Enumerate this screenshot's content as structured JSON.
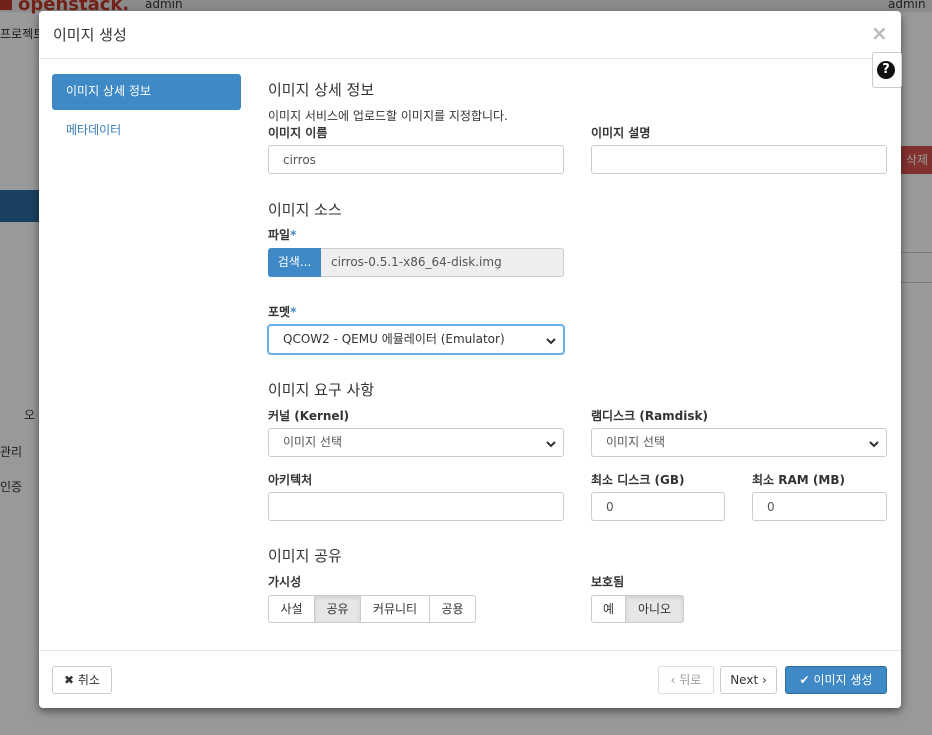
{
  "background": {
    "logo": "openstack.",
    "user_left": "admin",
    "user_right": "admin",
    "project": "프로젝트",
    "side_items": [
      "오",
      "관리",
      "인증"
    ],
    "red_button": "삭제"
  },
  "modal": {
    "title": "이미지 생성",
    "close": "×",
    "help": "?",
    "nav": {
      "active": "이미지 상세 정보",
      "item": "메타데이터"
    },
    "details": {
      "heading": "이미지 상세 정보",
      "help_text": "이미지 서비스에 업로드할 이미지를 지정합니다.",
      "name_label": "이미지 이름",
      "name_value": "cirros",
      "desc_label": "이미지 설명",
      "desc_value": ""
    },
    "source": {
      "heading": "이미지 소스",
      "file_label": "파일",
      "browse": "검색...",
      "file_name": "cirros-0.5.1-x86_64-disk.img",
      "format_label": "포멧",
      "format_value": "QCOW2 - QEMU 에뮬레이터 (Emulator)"
    },
    "requirements": {
      "heading": "이미지 요구 사항",
      "kernel_label": "커널 (Kernel)",
      "kernel_value": "이미지 선택",
      "ramdisk_label": "램디스크 (Ramdisk)",
      "ramdisk_value": "이미지 선택",
      "arch_label": "아키텍처",
      "arch_value": "",
      "min_disk_label": "최소 디스크 (GB)",
      "min_disk_value": "0",
      "min_ram_label": "최소 RAM (MB)",
      "min_ram_value": "0"
    },
    "sharing": {
      "heading": "이미지 공유",
      "visibility_label": "가시성",
      "visibility_options": [
        "사설",
        "공유",
        "커뮤니티",
        "공용"
      ],
      "visibility_selected": "공유",
      "protected_label": "보호됨",
      "protected_options": [
        "예",
        "아니오"
      ],
      "protected_selected": "아니오"
    },
    "footer": {
      "cancel": "취소",
      "back": "‹ 뒤로",
      "next": "Next ›",
      "create": "이미지 생성"
    }
  },
  "required_mark": "*",
  "colors": {
    "primary": "#3e89c6",
    "danger": "#d9534f"
  }
}
